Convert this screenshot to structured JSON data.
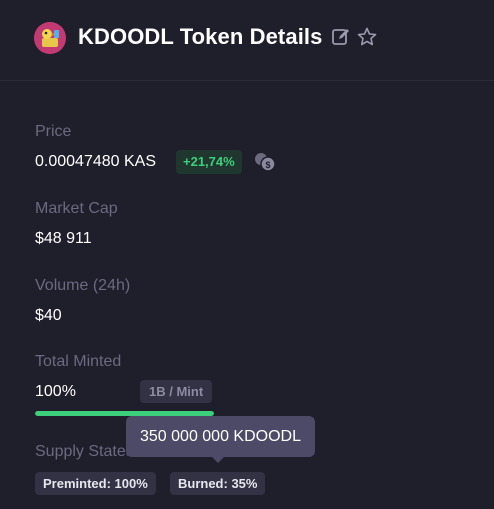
{
  "header": {
    "title": "KDOODL Token Details",
    "icons": [
      "edit-icon",
      "star-icon"
    ]
  },
  "price": {
    "label": "Price",
    "value": "0.00047480 KAS",
    "change": "+21,74%",
    "change_color": "#3ecf7c",
    "icon": "coin-icon"
  },
  "market_cap": {
    "label": "Market Cap",
    "value": "$48 911"
  },
  "volume": {
    "label": "Volume (24h)",
    "value": "$40"
  },
  "minted": {
    "label": "Total Minted",
    "value": "100%",
    "progress": 1.0,
    "per_mint": "1B / Mint",
    "bar_color": "#3ecf7c"
  },
  "supply": {
    "label": "Supply States",
    "preminted": "Preminted: 100%",
    "burned": "Burned: 35%",
    "tooltip": "350 000 000 KDOODL"
  }
}
